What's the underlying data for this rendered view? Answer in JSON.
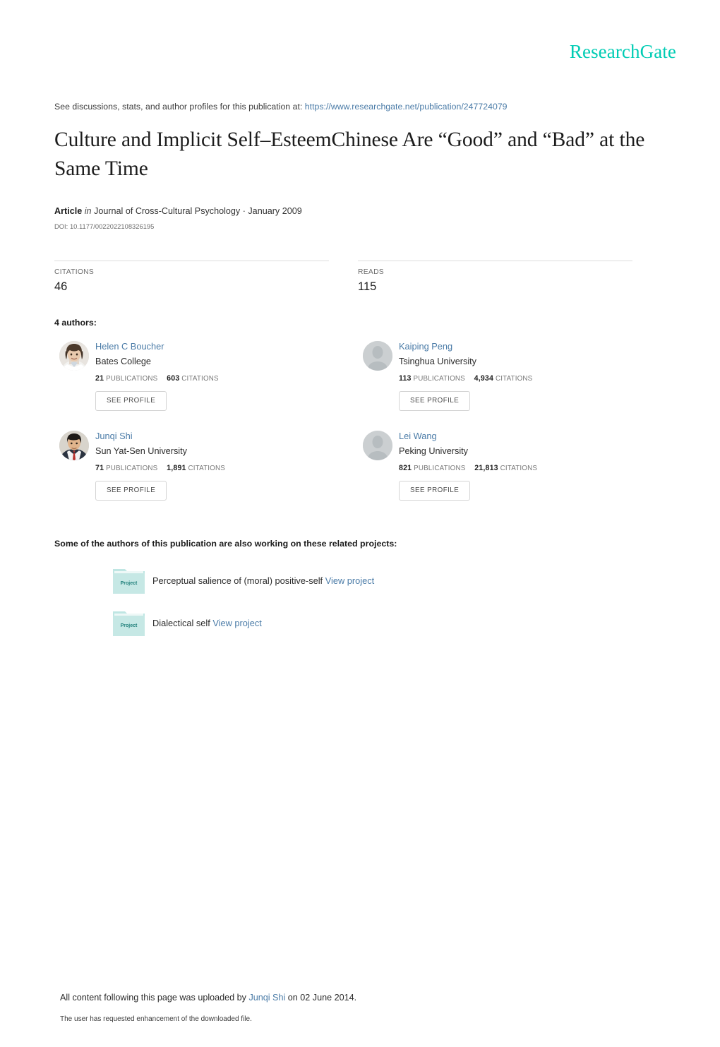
{
  "brand": {
    "name": "ResearchGate",
    "color": "#00ccb4"
  },
  "header": {
    "discussion_prefix": "See discussions, stats, and author profiles for this publication at:",
    "publication_url": "https://www.researchgate.net/publication/247724079"
  },
  "publication": {
    "title": "Culture and Implicit Self–EsteemChinese Are “Good” and “Bad” at the Same Time",
    "type_label": "Article",
    "in_label": "in",
    "journal_and_date": "Journal of Cross-Cultural Psychology · January 2009",
    "doi": "DOI: 10.1177/0022022108326195"
  },
  "stats": {
    "citations_label": "CITATIONS",
    "citations_value": "46",
    "reads_label": "READS",
    "reads_value": "115"
  },
  "authors_section": {
    "heading": "4 authors:",
    "see_profile_label": "SEE PROFILE",
    "publications_word": "PUBLICATIONS",
    "citations_word": "CITATIONS",
    "authors": [
      {
        "name": "Helen C Boucher",
        "affiliation": "Bates College",
        "publications": "21",
        "citations": "603",
        "avatar_type": "photo-female"
      },
      {
        "name": "Kaiping Peng",
        "affiliation": "Tsinghua University",
        "publications": "113",
        "citations": "4,934",
        "avatar_type": "placeholder"
      },
      {
        "name": "Junqi Shi",
        "affiliation": "Sun Yat-Sen University",
        "publications": "71",
        "citations": "1,891",
        "avatar_type": "photo-male"
      },
      {
        "name": "Lei Wang",
        "affiliation": "Peking University",
        "publications": "821",
        "citations": "21,813",
        "avatar_type": "placeholder"
      }
    ]
  },
  "projects_section": {
    "heading": "Some of the authors of this publication are also working on these related projects:",
    "folder_label": "Project",
    "view_project_label": "View project",
    "projects": [
      {
        "title": "Perceptual salience of (moral) positive-self"
      },
      {
        "title": "Dialectical self"
      }
    ]
  },
  "footer": {
    "upload_prefix": "All content following this page was uploaded by",
    "uploader": "Junqi Shi",
    "upload_suffix": "on 02 June 2014.",
    "enhancement_note": "The user has requested enhancement of the downloaded file."
  }
}
